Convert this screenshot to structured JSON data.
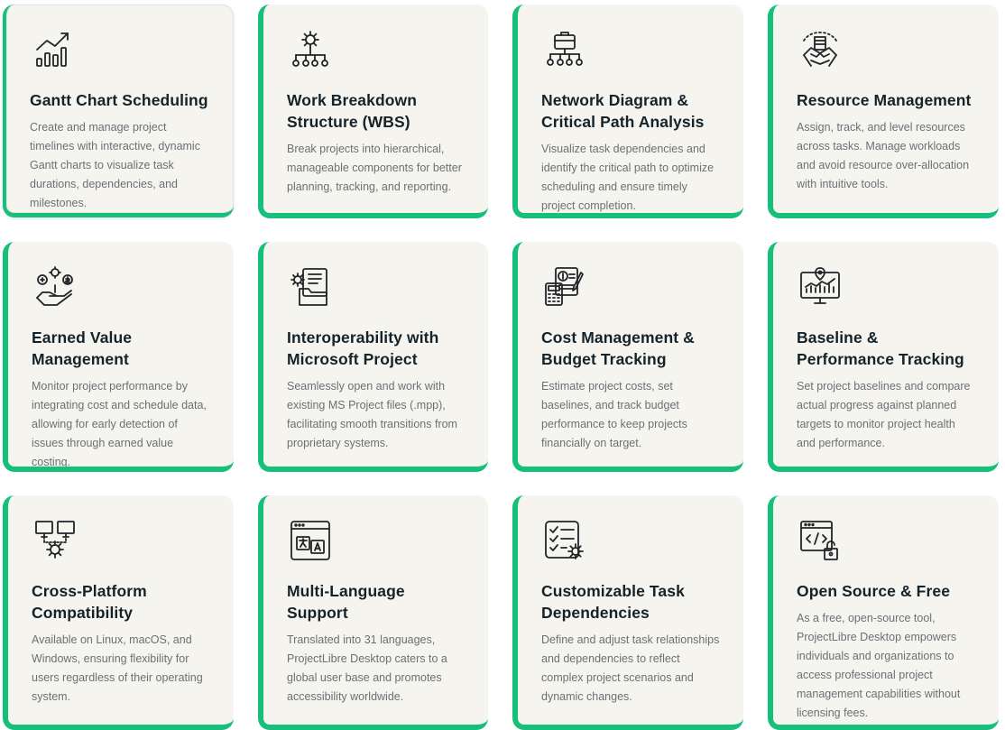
{
  "accent_color": "#17c07a",
  "card_background": "#f6f4ef",
  "cards": [
    {
      "icon": "growth-chart-icon",
      "title": "Gantt Chart Scheduling",
      "description": "Create and manage project timelines with interactive, dynamic Gantt charts to visualize task durations, dependencies, and milestones."
    },
    {
      "icon": "gear-hierarchy-icon",
      "title": "Work Breakdown Structure (WBS)",
      "description": "Break projects into hierarchical, manageable components for better planning, tracking, and reporting."
    },
    {
      "icon": "briefcase-network-icon",
      "title": "Network Diagram & Critical Path Analysis",
      "description": "Visualize task dependencies and identify the critical path to optimize scheduling and ensure timely project completion."
    },
    {
      "icon": "hands-teamwork-icon",
      "title": "Resource Management",
      "description": "Assign, track, and level resources across tasks. Manage workloads and avoid resource over-allocation with intuitive tools."
    },
    {
      "icon": "hand-coins-gear-icon",
      "title": "Earned Value Management",
      "description": "Monitor project performance by integrating cost and schedule data, allowing for early detection of issues through earned value costing."
    },
    {
      "icon": "gear-folder-icon",
      "title": "Interoperability with Microsoft Project",
      "description": "Seamlessly open and work with existing MS Project files (.mpp), facilitating smooth transitions from proprietary systems."
    },
    {
      "icon": "calculator-invoice-icon",
      "title": "Cost Management & Budget Tracking",
      "description": "Estimate project costs, set baselines, and track budget performance to keep projects financially on target."
    },
    {
      "icon": "monitor-chart-pin-icon",
      "title": "Baseline & Performance Tracking",
      "description": "Set project baselines and compare actual progress against planned targets to monitor project health and performance."
    },
    {
      "icon": "monitors-gear-icon",
      "title": "Cross-Platform Compatibility",
      "description": "Available on Linux, macOS, and Windows, ensuring flexibility for users regardless of their operating system."
    },
    {
      "icon": "translate-window-icon",
      "title": "Multi-Language Support",
      "description": "Translated into 31 languages, ProjectLibre Desktop caters to a global user base and promotes accessibility worldwide."
    },
    {
      "icon": "checklist-gear-icon",
      "title": "Customizable Task Dependencies",
      "description": "Define and adjust task relationships and dependencies to reflect complex project scenarios and dynamic changes."
    },
    {
      "icon": "code-window-lock-icon",
      "title": "Open Source & Free",
      "description": "As a free, open-source tool, ProjectLibre Desktop empowers individuals and organizations to access professional project management capabilities without licensing fees."
    }
  ]
}
